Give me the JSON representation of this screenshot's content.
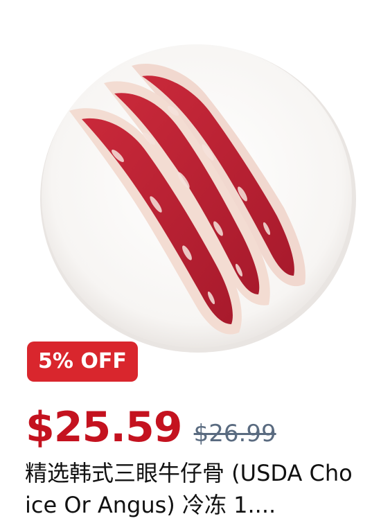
{
  "product": {
    "image_alt": "beef short ribs on white plate",
    "discount_badge": "5% OFF",
    "price": "$25.59",
    "original_price": "$26.99",
    "title": "精选韩式三眼牛仔骨 (USDA Choice Or Angus) 冷冻 1...."
  },
  "colors": {
    "badge_bg": "#d9262d",
    "price": "#c4121f",
    "original_price": "#5a6b80"
  }
}
